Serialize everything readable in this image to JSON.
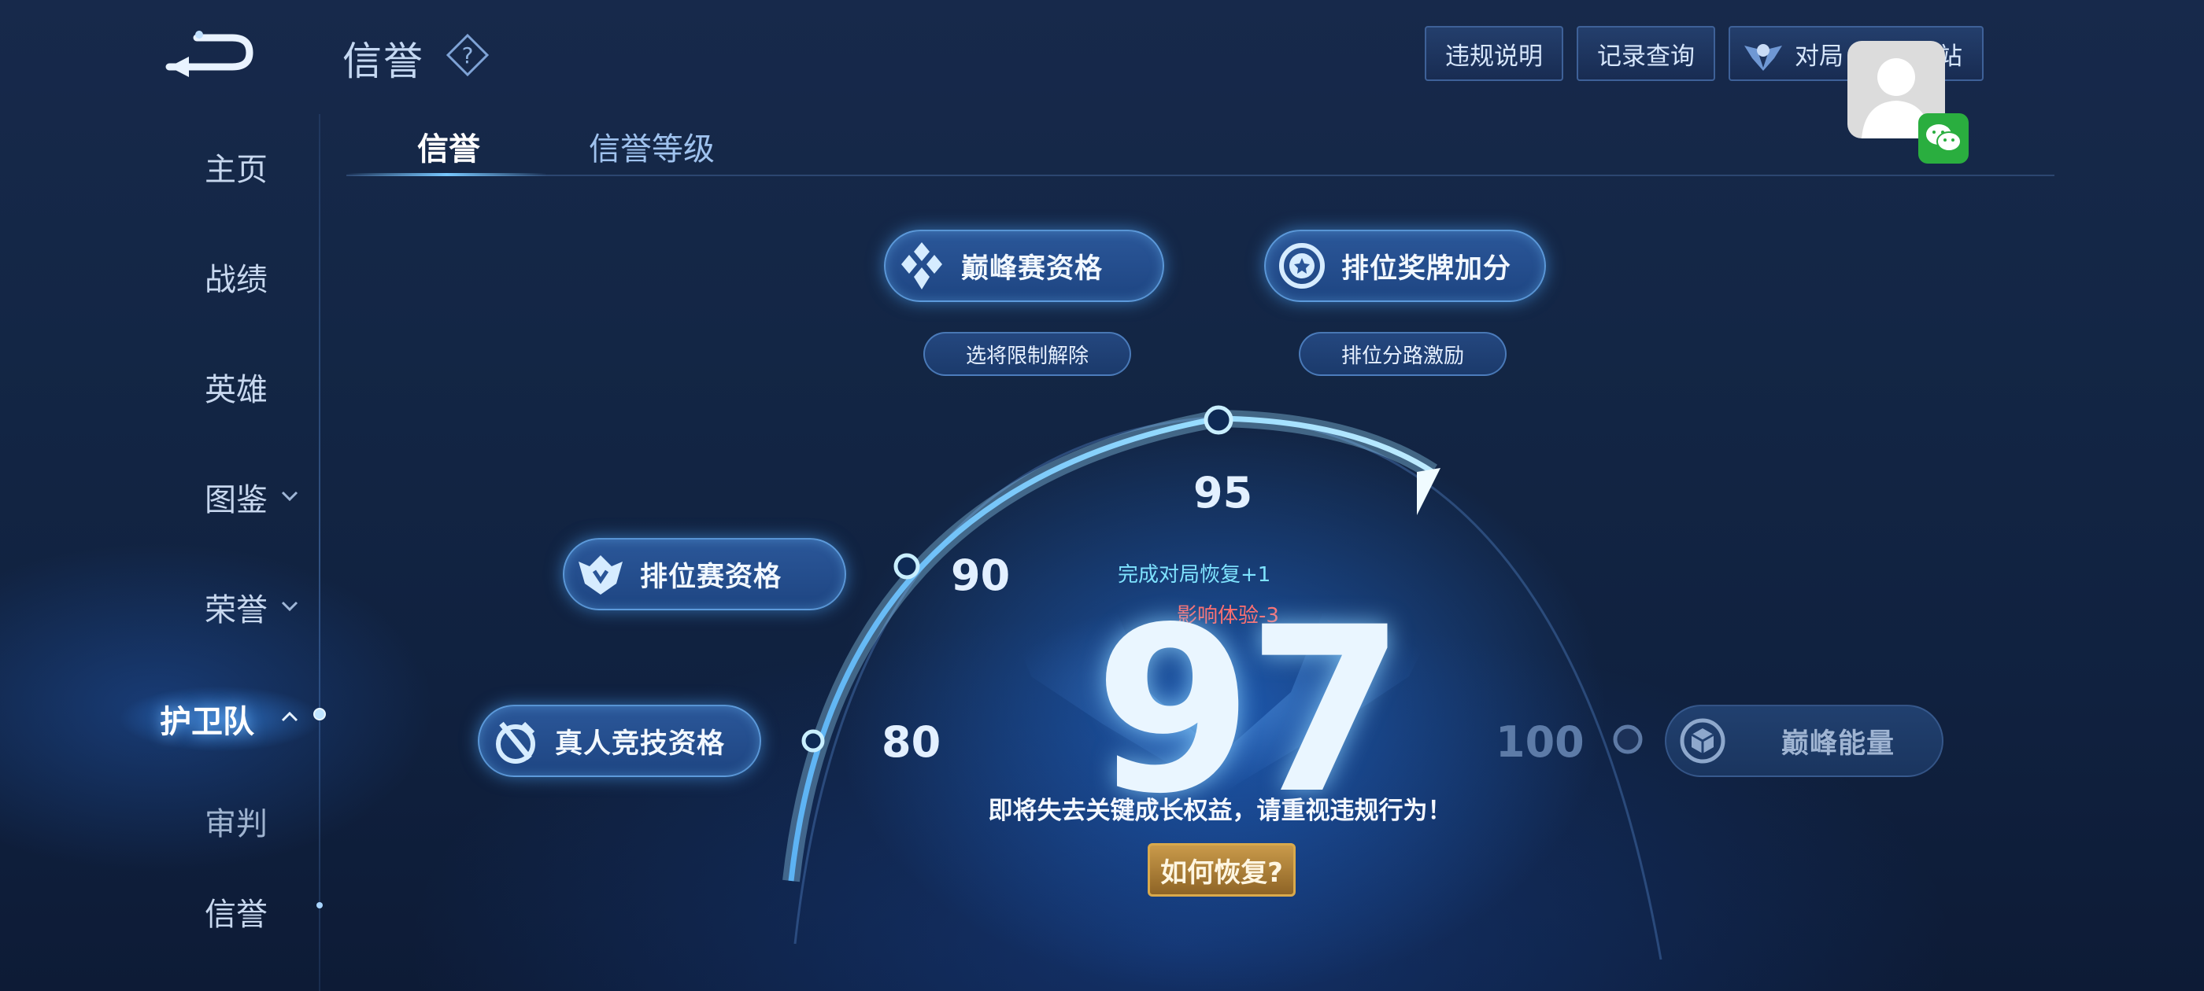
{
  "header": {
    "title": "信誉",
    "back_icon": "back-arrow-icon",
    "help_icon": "question-icon",
    "buttons": [
      {
        "label": "违规说明"
      },
      {
        "label": "记录查询"
      },
      {
        "label": "对局",
        "label_tail": "站",
        "icon": "shield-wings-icon"
      }
    ]
  },
  "overlay": {
    "avatar_icon": "user-avatar-icon",
    "badge_icon": "wechat-icon"
  },
  "sidebar": {
    "items": [
      {
        "label": "主页"
      },
      {
        "label": "战绩"
      },
      {
        "label": "英雄"
      },
      {
        "label": "图鉴"
      },
      {
        "label": "荣誉"
      },
      {
        "label": "护卫队"
      },
      {
        "label": "审判"
      },
      {
        "label": "信誉"
      }
    ]
  },
  "tabs": [
    {
      "label": "信誉"
    },
    {
      "label": "信誉等级"
    }
  ],
  "privileges": {
    "peak_match": {
      "label": "巅峰赛资格",
      "icon": "diamond-cluster-icon"
    },
    "rank_medal": {
      "label": "排位奖牌加分",
      "icon": "medal-star-icon"
    },
    "hero_limit": {
      "label": "选将限制解除"
    },
    "rank_lane": {
      "label": "排位分路激励"
    },
    "rank_match": {
      "label": "排位赛资格",
      "icon": "crown-shield-icon"
    },
    "pvp_match": {
      "label": "真人竞技资格",
      "icon": "sword-badge-icon"
    },
    "peak_energy": {
      "label": "巅峰能量",
      "icon": "cube-icon"
    }
  },
  "gauge": {
    "markers": [
      "80",
      "90",
      "95",
      "100"
    ],
    "current_score": "97",
    "recover_info": "完成对局恢复+1",
    "impact_info": "影响体验-3",
    "warning": "即将失去关键成长权益，请重视违规行为！",
    "recover_button": "如何恢复?"
  }
}
